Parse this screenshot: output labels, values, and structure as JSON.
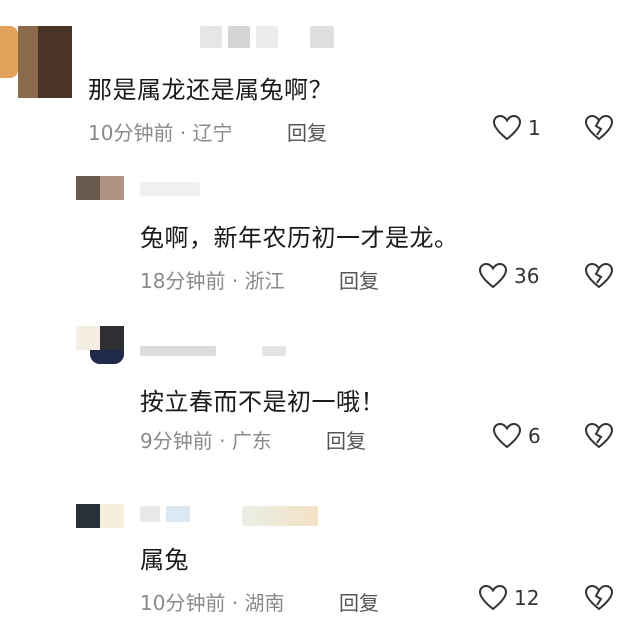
{
  "comments": [
    {
      "text": "那是属龙还是属兔啊？",
      "time": "10分钟前",
      "separator": "·",
      "location": "辽宁",
      "reply_label": "回复",
      "likes": "1"
    },
    {
      "text": "兔啊，新年农历初一才是龙。",
      "time": "18分钟前",
      "separator": "·",
      "location": "浙江",
      "reply_label": "回复",
      "likes": "36"
    },
    {
      "text": "按立春而不是初一哦！",
      "time": "9分钟前",
      "separator": "·",
      "location": "广东",
      "reply_label": "回复",
      "likes": "6"
    },
    {
      "text": "属兔",
      "time": "10分钟前",
      "separator": "·",
      "location": "湖南",
      "reply_label": "回复",
      "likes": "12"
    }
  ],
  "icons": {
    "like": "heart-outline-icon",
    "dislike": "broken-heart-icon"
  },
  "colors": {
    "text": "#1a1a1a",
    "meta": "#8a8a8a",
    "icon": "#333333"
  }
}
